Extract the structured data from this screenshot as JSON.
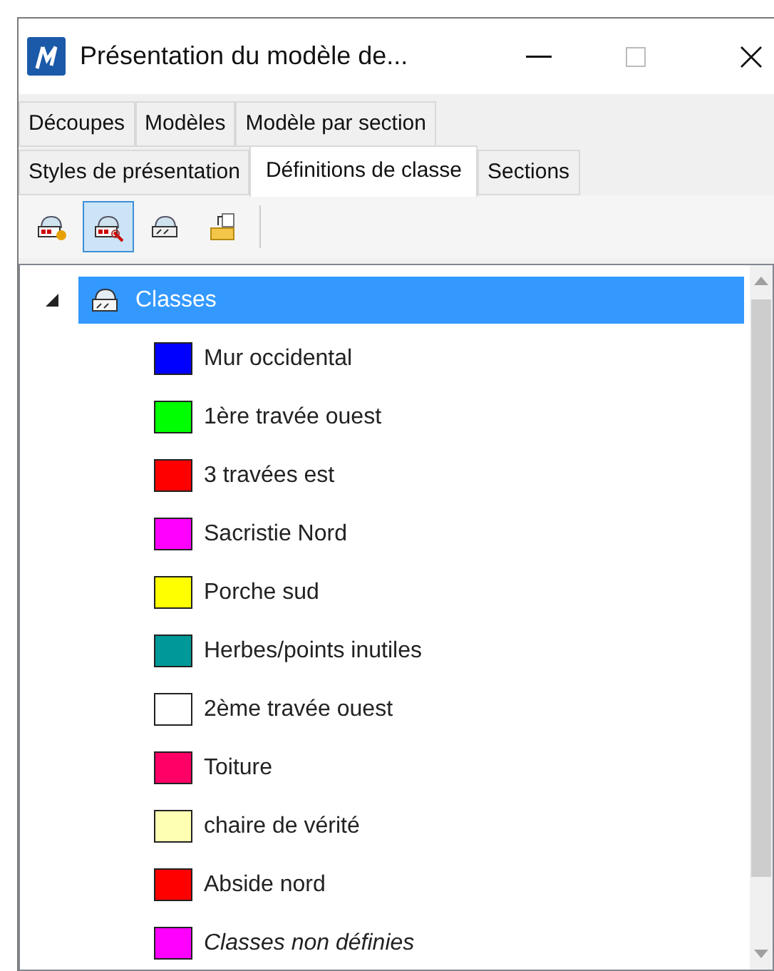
{
  "window": {
    "title": "Présentation du modèle de..."
  },
  "tab_rows": [
    [
      {
        "label": "Découpes",
        "selected": false
      },
      {
        "label": "Modèles",
        "selected": false
      },
      {
        "label": "Modèle par section",
        "selected": false
      }
    ],
    [
      {
        "label": "Styles de présentation",
        "selected": false
      },
      {
        "label": "Définitions de classe",
        "selected": true
      },
      {
        "label": "Sections",
        "selected": false
      }
    ]
  ],
  "toolbar": [
    {
      "kind": "add",
      "selected": false
    },
    {
      "kind": "remove",
      "selected": true
    },
    {
      "kind": "edit",
      "selected": false
    },
    {
      "kind": "import",
      "selected": false
    }
  ],
  "tree": {
    "label": "Classes",
    "expanded": true,
    "selected": true,
    "children": [
      {
        "label": "Mur occidental",
        "color": "#0000ff",
        "kind": "class"
      },
      {
        "label": "1ère travée ouest",
        "color": "#00ff00",
        "kind": "class"
      },
      {
        "label": "3 travées est",
        "color": "#ff0000",
        "kind": "class"
      },
      {
        "label": "Sacristie Nord",
        "color": "#ff00ff",
        "kind": "class"
      },
      {
        "label": "Porche sud",
        "color": "#ffff00",
        "kind": "class"
      },
      {
        "label": "Herbes/points inutiles",
        "color": "#009999",
        "kind": "class"
      },
      {
        "label": "2ème travée ouest",
        "color": "#ffffff",
        "kind": "class"
      },
      {
        "label": "Toiture",
        "color": "#ff0066",
        "kind": "class"
      },
      {
        "label": "chaire de vérité",
        "color": "#ffffb3",
        "kind": "class"
      },
      {
        "label": "Abside nord",
        "color": "#ff0000",
        "kind": "class"
      },
      {
        "label": "Classes non définies",
        "color": "#ff00ff",
        "kind": "undefined"
      }
    ]
  }
}
